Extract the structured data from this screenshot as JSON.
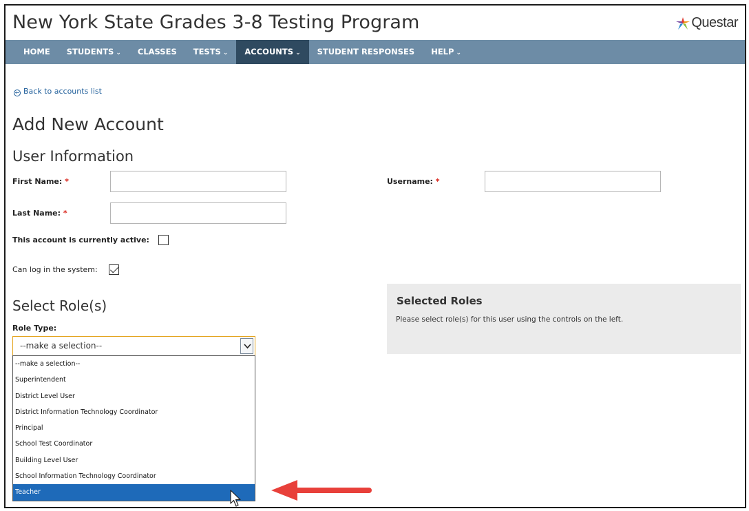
{
  "header": {
    "title": "New York State Grades 3-8 Testing Program",
    "logo_text": "Questar",
    "logo_colors": [
      "#e03a2f",
      "#f29a1e",
      "#8cbf3f",
      "#2d8fd5",
      "#7b4fa5"
    ]
  },
  "nav": {
    "items": [
      {
        "label": "HOME",
        "has_caret": false,
        "active": false
      },
      {
        "label": "STUDENTS",
        "has_caret": true,
        "active": false
      },
      {
        "label": "CLASSES",
        "has_caret": false,
        "active": false
      },
      {
        "label": "TESTS",
        "has_caret": true,
        "active": false
      },
      {
        "label": "ACCOUNTS",
        "has_caret": true,
        "active": true
      },
      {
        "label": "STUDENT RESPONSES",
        "has_caret": false,
        "active": false
      },
      {
        "label": "HELP",
        "has_caret": true,
        "active": false
      }
    ],
    "bg_color": "#6d8ca6",
    "active_color": "#2f4a60"
  },
  "back_link": {
    "label": "Back to accounts list"
  },
  "page_title": "Add New Account",
  "user_info": {
    "heading": "User Information",
    "first_name_label": "First Name:",
    "last_name_label": "Last Name:",
    "username_label": "Username:",
    "required_marker": "*",
    "first_name_value": "",
    "last_name_value": "",
    "username_value": "",
    "active_label": "This account is currently active:",
    "active_checked": false,
    "login_label": "Can log in the system:",
    "login_checked": true
  },
  "roles": {
    "heading": "Select Role(s)",
    "role_type_label": "Role Type:",
    "selected_value": "--make a selection--",
    "options": [
      "--make a selection--",
      "Superintendent",
      "District Level User",
      "District Information Technology Coordinator",
      "Principal",
      "School Test Coordinator",
      "Building Level User",
      "School Information Technology Coordinator",
      "Teacher"
    ],
    "highlighted_option": "Teacher",
    "selected_panel_title": "Selected Roles",
    "selected_panel_msg": "Please select role(s) for this user using the controls on the left."
  },
  "annotation": {
    "arrow_color": "#e8403a",
    "highlight_color": "#1e6ab9"
  }
}
